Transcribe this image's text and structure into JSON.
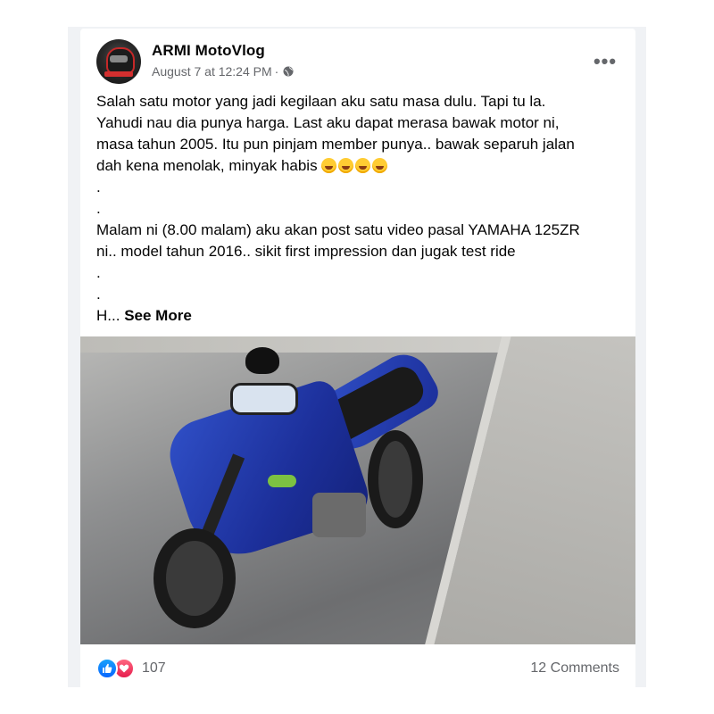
{
  "post": {
    "page_name": "ARMI MotoVlog",
    "timestamp": "August 7 at 12:24 PM",
    "separator": "·",
    "privacy_icon": "globe-icon",
    "more_icon": "more-options-icon",
    "text_lines": [
      "Salah satu motor yang jadi kegilaan aku satu masa dulu. Tapi tu la.",
      "Yahudi nau dia punya harga. Last aku dapat merasa bawak motor ni,",
      "masa tahun 2005. Itu pun pinjam member punya.. bawak separuh jalan",
      "dah kena menolak, minyak habis",
      ".",
      ".",
      "Malam ni (8.00 malam) aku akan post satu video pasal YAMAHA 125ZR",
      "ni.. model tahun 2016.. sikit first impression dan jugak test ride",
      ".",
      ".",
      "H..."
    ],
    "emojis": [
      "rofl-emoji",
      "rofl-emoji",
      "rolling-laugh-emoji",
      "rolling-laugh-emoji"
    ],
    "see_more": "See More",
    "photo_subject": "blue Yamaha 125ZR motorcycle parked on road"
  },
  "footer": {
    "reaction_icons": [
      "like-icon",
      "love-icon"
    ],
    "reaction_count": "107",
    "comments": "12 Comments"
  },
  "colors": {
    "like": "#0866ff",
    "love": "#e61e4d",
    "secondary_text": "#65676b",
    "primary_text": "#050505",
    "frame_bg": "#f0f2f5"
  }
}
